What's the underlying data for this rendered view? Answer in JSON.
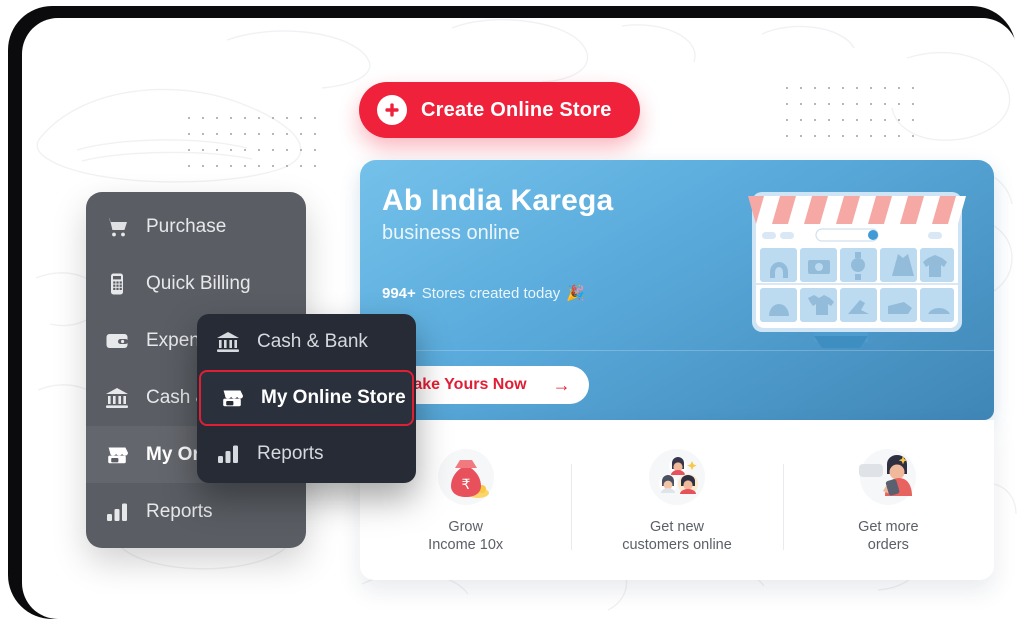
{
  "cta": {
    "label": "Create Online Store",
    "icon": "plus-circle-icon",
    "color": "#f0223b"
  },
  "sidebar": {
    "items": [
      {
        "label": "Purchase",
        "icon": "shopping-cart-icon",
        "active": false
      },
      {
        "label": "Quick Billing",
        "icon": "calculator-icon",
        "active": false
      },
      {
        "label": "Expense",
        "icon": "wallet-icon",
        "active": false
      },
      {
        "label": "Cash & Bank",
        "icon": "bank-icon",
        "active": false
      },
      {
        "label": "My Online Store",
        "icon": "store-icon",
        "active": true
      },
      {
        "label": "Reports",
        "icon": "bar-chart-icon",
        "active": false
      }
    ]
  },
  "flyout": {
    "items": [
      {
        "label": "Cash & Bank",
        "icon": "bank-icon",
        "selected": false
      },
      {
        "label": "My Online Store",
        "icon": "store-icon",
        "selected": true
      },
      {
        "label": "Reports",
        "icon": "bar-chart-icon",
        "selected": false
      }
    ],
    "highlight_color": "#e01f35"
  },
  "promo": {
    "title": "Ab India Karega",
    "subtitle": "business online",
    "stat_count": "994+",
    "stat_text": "Stores created today",
    "stat_emoji": "🎉",
    "button_label": "Make Yours Now",
    "button_arrow": "→",
    "gradient_from": "#74c1ea",
    "gradient_to": "#3f86b6",
    "illustration": "online-storefront-illustration"
  },
  "features": [
    {
      "line1": "Grow",
      "line2": "Income 10x",
      "icon": "money-bag-icon"
    },
    {
      "line1": "Get new",
      "line2": "customers online",
      "icon": "customers-group-icon"
    },
    {
      "line1": "Get more",
      "line2": "orders",
      "icon": "person-megaphone-icon"
    }
  ]
}
